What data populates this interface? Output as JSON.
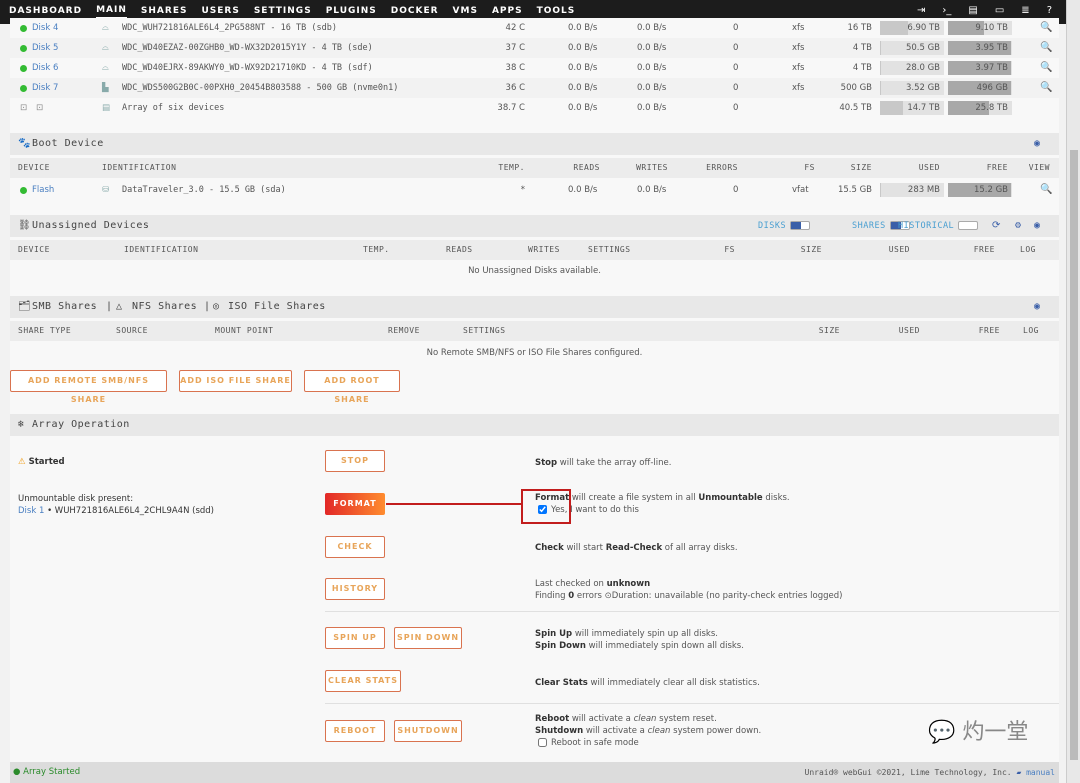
{
  "nav": {
    "items": [
      "DASHBOARD",
      "MAIN",
      "SHARES",
      "USERS",
      "SETTINGS",
      "PLUGINS",
      "DOCKER",
      "VMS",
      "APPS",
      "TOOLS"
    ],
    "active": "MAIN",
    "icons": [
      "logout-icon",
      "terminal-icon",
      "feedback-icon",
      "info-icon",
      "log-icon",
      "help-icon"
    ]
  },
  "array_disks": [
    {
      "name": "Disk 4",
      "id": "WDC_WUH721816ALE6L4_2PG588NT - 16 TB (sdb)",
      "temp": "42 C",
      "reads": "0.0 B/s",
      "writes": "0.0 B/s",
      "errors": "0",
      "fs": "xfs",
      "size": "16 TB",
      "used": "6.90 TB",
      "free": "9.10 TB",
      "used_frac": 0.43,
      "free_frac": 0.57
    },
    {
      "name": "Disk 5",
      "id": "WDC_WD40EZAZ-00ZGHB0_WD-WX32D2015Y1Y - 4 TB (sde)",
      "temp": "37 C",
      "reads": "0.0 B/s",
      "writes": "0.0 B/s",
      "errors": "0",
      "fs": "xfs",
      "size": "4 TB",
      "used": "50.5 GB",
      "free": "3.95 TB",
      "used_frac": 0.01,
      "free_frac": 0.99
    },
    {
      "name": "Disk 6",
      "id": "WDC_WD40EJRX-89AKWY0_WD-WX92D21710KD - 4 TB (sdf)",
      "temp": "38 C",
      "reads": "0.0 B/s",
      "writes": "0.0 B/s",
      "errors": "0",
      "fs": "xfs",
      "size": "4 TB",
      "used": "28.0 GB",
      "free": "3.97 TB",
      "used_frac": 0.01,
      "free_frac": 0.99
    },
    {
      "name": "Disk 7",
      "id": "WDC_WDS500G2B0C-00PXH0_20454B803588 - 500 GB (nvme0n1)",
      "temp": "36 C",
      "reads": "0.0 B/s",
      "writes": "0.0 B/s",
      "errors": "0",
      "fs": "xfs",
      "size": "500 GB",
      "used": "3.52 GB",
      "free": "496 GB",
      "used_frac": 0.01,
      "free_frac": 0.99
    }
  ],
  "array_total": {
    "label": "Array of six devices",
    "temp": "38.7 C",
    "reads": "0.0 B/s",
    "writes": "0.0 B/s",
    "errors": "0",
    "size": "40.5 TB",
    "used": "14.7 TB",
    "free": "25.8 TB",
    "used_frac": 0.36,
    "free_frac": 0.64
  },
  "boot": {
    "title": "Boot Device",
    "columns": [
      "DEVICE",
      "IDENTIFICATION",
      "TEMP.",
      "READS",
      "WRITES",
      "ERRORS",
      "FS",
      "SIZE",
      "USED",
      "FREE",
      "VIEW"
    ],
    "row": {
      "name": "Flash",
      "id": "DataTraveler_3.0 - 15.5 GB (sda)",
      "temp": "*",
      "reads": "0.0 B/s",
      "writes": "0.0 B/s",
      "errors": "0",
      "fs": "vfat",
      "size": "15.5 GB",
      "used": "283 MB",
      "free": "15.2 GB",
      "used_frac": 0.02,
      "free_frac": 0.98
    }
  },
  "unassigned": {
    "title": "Unassigned Devices",
    "toggles": [
      "DISKS",
      "SHARES",
      "HISTORICAL"
    ],
    "columns": [
      "DEVICE",
      "IDENTIFICATION",
      "TEMP.",
      "READS",
      "WRITES",
      "SETTINGS",
      "FS",
      "SIZE",
      "USED",
      "FREE",
      "LOG"
    ],
    "empty": "No Unassigned Disks available."
  },
  "remote": {
    "title_smb": "SMB Shares",
    "title_nfs": "NFS Shares",
    "title_iso": "ISO File Shares",
    "sep": "|",
    "columns": [
      "SHARE TYPE",
      "SOURCE",
      "MOUNT POINT",
      "REMOVE",
      "SETTINGS",
      "SIZE",
      "USED",
      "FREE",
      "LOG"
    ],
    "empty": "No Remote SMB/NFS or ISO File Shares configured.",
    "buttons": [
      "ADD REMOTE SMB/NFS SHARE",
      "ADD ISO FILE SHARE",
      "ADD ROOT SHARE"
    ]
  },
  "array_op": {
    "title": "Array Operation",
    "status": "Started",
    "unmountable_label": "Unmountable disk present:",
    "unmountable_disk": "Disk 1",
    "unmountable_id": "• WUH721816ALE6L4_2CHL9A4N (sdd)",
    "buttons": {
      "stop": "STOP",
      "format": "FORMAT",
      "check": "CHECK",
      "history": "HISTORY",
      "spin_up": "SPIN UP",
      "spin_down": "SPIN DOWN",
      "clear_stats": "CLEAR STATS",
      "reboot": "REBOOT",
      "shutdown": "SHUTDOWN"
    },
    "stop_b": "Stop",
    "stop_t": " will take the array off-line.",
    "format_b": "Format",
    "format_t": " will create a file system in all ",
    "format_b2": "Unmountable",
    "format_t2": " disks.",
    "format_confirm": "Yes, I want to do this",
    "format_checked": true,
    "check_b": "Check",
    "check_t": " will start ",
    "check_b2": "Read-Check",
    "check_t2": " of all array disks.",
    "hist_t": "Last checked on ",
    "hist_b": "unknown",
    "hist_t2": "Finding ",
    "hist_b2": "0",
    "hist_t3": " errors ",
    "hist_t4": "Duration: unavailable (no parity-check entries logged)",
    "spinup_b": "Spin Up",
    "spinup_t": " will immediately spin up all disks.",
    "spindown_b": "Spin Down",
    "spindown_t": " will immediately spin down all disks.",
    "clear_b": "Clear Stats",
    "clear_t": " will immediately clear all disk statistics.",
    "reboot_b": "Reboot",
    "reboot_t": " will activate a ",
    "reboot_i": "clean",
    "reboot_t2": " system reset.",
    "shut_b": "Shutdown",
    "shut_t": " will activate a ",
    "shut_i": "clean",
    "shut_t2": " system power down.",
    "safe_mode": "Reboot in safe mode"
  },
  "footer": {
    "status": "Array Started",
    "copyright": "Unraid® webGui ©2021, Lime Technology, Inc.",
    "manual": "manual"
  },
  "watermark": "灼一堂"
}
